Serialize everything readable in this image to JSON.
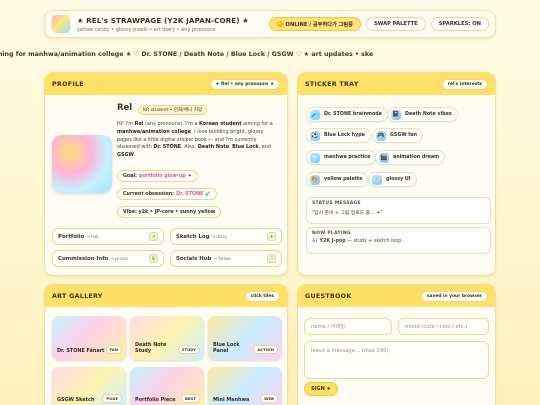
{
  "header": {
    "title": "★ REL's STRAWPAGE (Y2K JAPAN-CORE) ★",
    "subtitle": "yellow candy • glossy pixels • art diary • any pronouns",
    "status_icon": "sparkle-dot-icon",
    "status_label": "ONLINE / 공부하다가 그림중",
    "swap_palette_label": "SWAP PALETTE",
    "sparkles_label": "SPARKLES: ON"
  },
  "marquee": {
    "text": "ent → aiming for manhwa/animation college ★    ♡ Dr. STONE / Death Note / Blue Lock / GSGW ♡    ★ art updates • ske"
  },
  "profile": {
    "title": "PROFILE",
    "chip": "★ Rel • any pronouns ★",
    "name": "Rel",
    "name_badge": "KR student • 만화/애니 지망",
    "bio_parts": {
      "p1": "Hi! I'm ",
      "name": "Rel",
      "p2": " (any pronouns). I'm a ",
      "korean": "Korean student",
      "p3": " aiming for a ",
      "college": "manhwa/animation college",
      "p4": ". I love building bright, glossy pages like a little digital sticker book — and I'm currently obsessed with ",
      "drstone": "Dr. STONE",
      "p5": ". Also: ",
      "deathnote": "Death Note",
      "p6": ", ",
      "bluelock": "Blue Lock",
      "p7": ", and ",
      "gsgw": "GSGW",
      "p8": "."
    },
    "goal_label": "Goal:",
    "goal_value": "portfolio glow-up",
    "goal_icon": "✦",
    "obsession_label": "Current obsession:",
    "obsession_value": "Dr. STONE",
    "obsession_icon": "🧪",
    "vibe_label": "Vibe: y2k • JP-core • sunny yellow",
    "links": [
      {
        "label": "Portfolio",
        "sub": "→ link",
        "icon": "↗"
      },
      {
        "label": "Sketch Log",
        "sub": "→ diary",
        "icon": "+"
      },
      {
        "label": "Commission Info",
        "sub": "→ prices",
        "icon": "$"
      },
      {
        "label": "Socials Hub",
        "sub": "→ follow",
        "icon": "♡"
      }
    ]
  },
  "stickers": {
    "title": "STICKER TRAY",
    "chip": "rel's interests",
    "items": [
      {
        "label": "Dr. STONE brainmode",
        "icon": "🧪"
      },
      {
        "label": "Death Note vibes",
        "icon": "📓"
      },
      {
        "label": "Blue Lock hype",
        "icon": "⚽"
      },
      {
        "label": "GSGW fan",
        "icon": "🎮"
      },
      {
        "label": "manhwa practice",
        "icon": "✏"
      },
      {
        "label": "animation dream",
        "icon": "🎬"
      },
      {
        "label": "yellow palette",
        "icon": "🎨"
      },
      {
        "label": "glossy UI",
        "icon": "💿"
      }
    ],
    "status_title": "STATUS MESSAGE",
    "status_value": "\"입시 준비 + 그림 업로드 중… ✦\"",
    "playing_title": "NOW PLAYING",
    "playing_icon": "🎶",
    "playing_value": "Y2K J-pop",
    "playing_suffix": " — study + sketch loop"
  },
  "gallery": {
    "title": "ART GALLERY",
    "chip": "click tiles",
    "items": [
      {
        "title": "Dr. STONE Fanart",
        "tag": "FAN"
      },
      {
        "title": "Death Note Study",
        "tag": "STUDY"
      },
      {
        "title": "Blue Lock Panel",
        "tag": "ACTION"
      },
      {
        "title": "GSGW Sketch",
        "tag": "POSE"
      },
      {
        "title": "Portfolio Piece",
        "tag": "BEST"
      },
      {
        "title": "Mini Manhwa",
        "tag": "WEB"
      }
    ]
  },
  "guestbook": {
    "title": "GUESTBOOK",
    "chip": "saved in your browser",
    "name_placeholder": "name / 닉네임",
    "mood_placeholder": "mood (cute / cool / etc.)",
    "message_placeholder": "leave a message… (max 240)",
    "sign_label": "SIGN ★"
  }
}
